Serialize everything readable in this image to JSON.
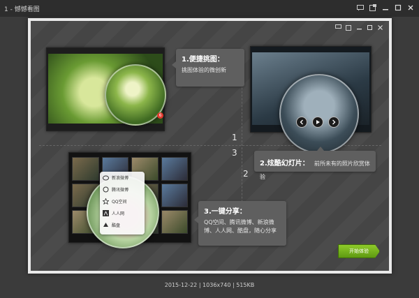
{
  "window": {
    "title": "1 - 憾憾看图"
  },
  "welcome": {
    "numbers": [
      "1",
      "2",
      "3"
    ],
    "feature1": {
      "title": "1.便捷挑图：",
      "desc": "挑图体验的微创新"
    },
    "feature2": {
      "title": "2.炫酷幻灯片：",
      "desc": "前所未有的照片欣赏体验"
    },
    "feature3": {
      "title": "3.一键分享：",
      "desc": "QQ空间、腾讯微博、新浪微博、人人网、酷盘，随心分享"
    },
    "badge_count": "6",
    "share_menu": [
      "新浪微博",
      "腾讯微博",
      "QQ空间",
      "人人网",
      "酷盘"
    ],
    "start_button": "开始体验"
  },
  "status": {
    "text": "2015-12-22 | 1036x740 | 515KB"
  },
  "icons": [
    "chat-icon",
    "skin-icon",
    "minimize-icon",
    "maximize-icon",
    "close-icon",
    "prev-icon",
    "play-icon",
    "next-icon"
  ]
}
